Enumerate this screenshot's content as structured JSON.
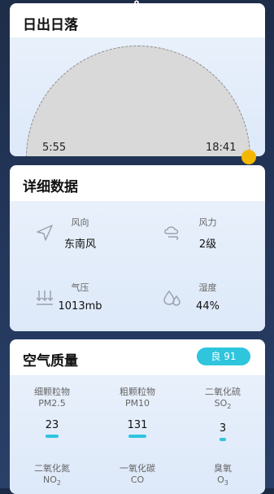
{
  "sun": {
    "title": "日出日落",
    "sunrise": "5:55",
    "sunset": "18:41"
  },
  "details": {
    "title": "详细数据",
    "items": [
      {
        "label": "风向",
        "value": "东南风",
        "icon": "navigation-arrow-icon"
      },
      {
        "label": "风力",
        "value": "2级",
        "icon": "wind-cloud-icon"
      },
      {
        "label": "气压",
        "value": "1013mb",
        "icon": "pressure-arrows-icon"
      },
      {
        "label": "湿度",
        "value": "44%",
        "icon": "humidity-drops-icon"
      }
    ]
  },
  "air": {
    "title": "空气质量",
    "badge": "良  91",
    "colors": {
      "accent": "#2ec5dd",
      "sun": "#f5b800"
    },
    "items": [
      {
        "name": "细颗粒物",
        "code": "PM2.5",
        "value": "23"
      },
      {
        "name": "粗颗粒物",
        "code": "PM10",
        "value": "131"
      },
      {
        "name": "二氧化硫",
        "code": "SO",
        "sub": "2",
        "value": "3"
      },
      {
        "name": "二氧化氮",
        "code": "NO",
        "sub": "2",
        "value": ""
      },
      {
        "name": "一氧化碳",
        "code": "CO",
        "value": ""
      },
      {
        "name": "臭氧",
        "code": "O",
        "sub": "3",
        "value": ""
      }
    ]
  }
}
